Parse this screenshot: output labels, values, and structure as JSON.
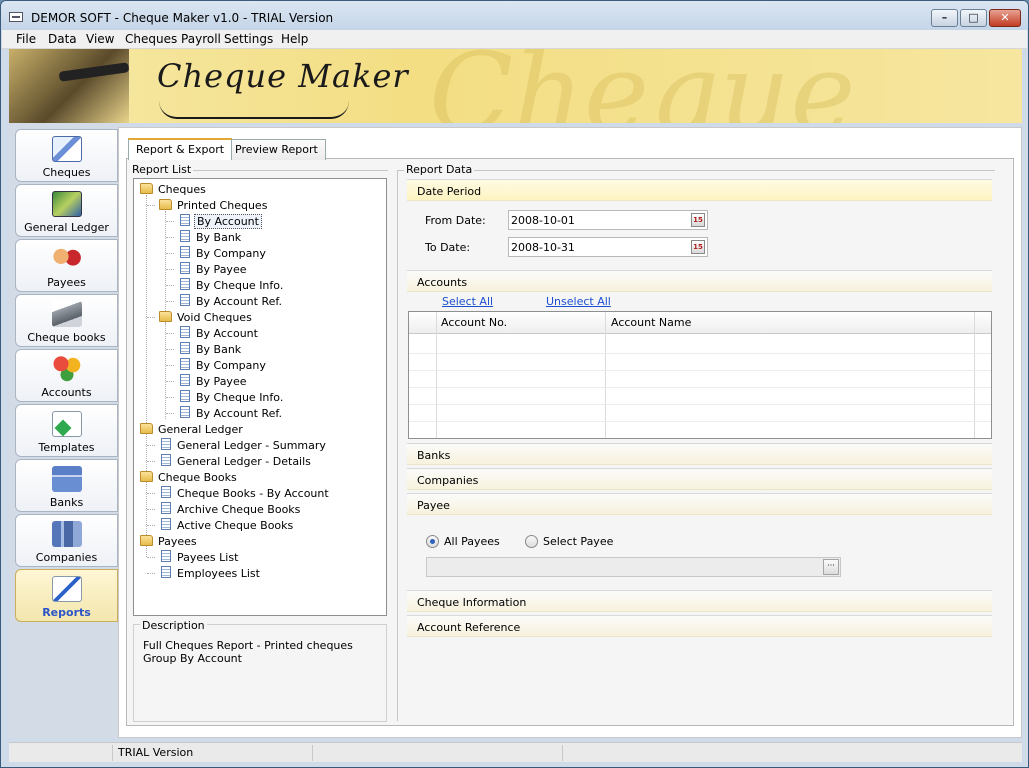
{
  "window": {
    "title": "DEMOR SOFT - Cheque Maker v1.0 - TRIAL Version"
  },
  "menu": [
    "File",
    "Data",
    "View",
    "Cheques Payroll",
    "Settings",
    "Help"
  ],
  "banner": {
    "logo_text": "Cheque Maker"
  },
  "nav": [
    {
      "label": "Cheques",
      "icon": "cheques-icon"
    },
    {
      "label": "General Ledger",
      "icon": "general-ledger-icon"
    },
    {
      "label": "Payees",
      "icon": "payees-icon"
    },
    {
      "label": "Cheque books",
      "icon": "cheque-books-icon"
    },
    {
      "label": "Accounts",
      "icon": "accounts-icon"
    },
    {
      "label": "Templates",
      "icon": "templates-icon"
    },
    {
      "label": "Banks",
      "icon": "banks-icon"
    },
    {
      "label": "Companies",
      "icon": "companies-icon"
    },
    {
      "label": "Reports",
      "icon": "reports-icon",
      "active": true
    }
  ],
  "tabs": [
    "Report & Export",
    "Preview Report"
  ],
  "report_list": {
    "label": "Report List",
    "tree": [
      {
        "text": "Cheques",
        "type": "folder",
        "level": 0
      },
      {
        "text": "Printed Cheques",
        "type": "folder",
        "level": 1
      },
      {
        "text": "By Account",
        "type": "doc",
        "level": 2,
        "selected": true
      },
      {
        "text": "By Bank",
        "type": "doc",
        "level": 2
      },
      {
        "text": "By Company",
        "type": "doc",
        "level": 2
      },
      {
        "text": "By Payee",
        "type": "doc",
        "level": 2
      },
      {
        "text": "By Cheque Info.",
        "type": "doc",
        "level": 2
      },
      {
        "text": "By Account Ref.",
        "type": "doc",
        "level": 2
      },
      {
        "text": "Void Cheques",
        "type": "folder",
        "level": 1
      },
      {
        "text": "By Account",
        "type": "doc",
        "level": 2
      },
      {
        "text": "By Bank",
        "type": "doc",
        "level": 2
      },
      {
        "text": "By Company",
        "type": "doc",
        "level": 2
      },
      {
        "text": "By Payee",
        "type": "doc",
        "level": 2
      },
      {
        "text": "By Cheque Info.",
        "type": "doc",
        "level": 2
      },
      {
        "text": "By Account Ref.",
        "type": "doc",
        "level": 2
      },
      {
        "text": "General Ledger",
        "type": "folder",
        "level": 0
      },
      {
        "text": "General Ledger - Summary",
        "type": "doc",
        "level": 1
      },
      {
        "text": "General Ledger - Details",
        "type": "doc",
        "level": 1
      },
      {
        "text": "Cheque Books",
        "type": "folder",
        "level": 0
      },
      {
        "text": "Cheque Books - By Account",
        "type": "doc",
        "level": 1
      },
      {
        "text": "Archive Cheque Books",
        "type": "doc",
        "level": 1
      },
      {
        "text": "Active Cheque Books",
        "type": "doc",
        "level": 1
      },
      {
        "text": "Payees",
        "type": "folder",
        "level": 0
      },
      {
        "text": "Payees List",
        "type": "doc",
        "level": 1
      },
      {
        "text": "Employees List",
        "type": "doc",
        "level": 1
      }
    ]
  },
  "description": {
    "label": "Description",
    "line1": "Full Cheques Report - Printed cheques",
    "line2": "Group By Account"
  },
  "report_data": {
    "label": "Report  Data",
    "date_period": {
      "header": "Date Period",
      "from_label": "From Date:",
      "from_value": "2008-10-01",
      "to_label": "To Date:",
      "to_value": "2008-10-31",
      "calendar_glyph": "15"
    },
    "accounts": {
      "header": "Accounts",
      "select_all": "Select All",
      "unselect_all": "Unselect All",
      "columns": [
        "Account No.",
        "Account Name"
      ]
    },
    "banks_header": "Banks",
    "companies_header": "Companies",
    "payee": {
      "header": "Payee",
      "all_payees": "All Payees",
      "select_payee": "Select Payee",
      "selected": "all"
    },
    "cheque_info_header": "Cheque Information",
    "account_ref_header": "Account Reference"
  },
  "status": {
    "text": "TRIAL Version"
  }
}
